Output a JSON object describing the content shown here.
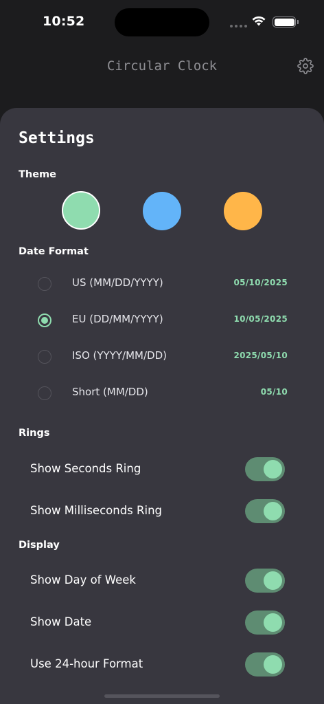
{
  "status": {
    "time": "10:52"
  },
  "header": {
    "title": "Circular Clock"
  },
  "settings": {
    "title": "Settings",
    "theme": {
      "label": "Theme",
      "swatches": [
        {
          "color": "#8fdcaf",
          "selected": true
        },
        {
          "color": "#63b4f9",
          "selected": false
        },
        {
          "color": "#ffb649",
          "selected": false
        }
      ]
    },
    "date_format": {
      "label": "Date Format",
      "options": [
        {
          "label": "US (MM/DD/YYYY)",
          "preview": "05/10/2025",
          "selected": false
        },
        {
          "label": "EU (DD/MM/YYYY)",
          "preview": "10/05/2025",
          "selected": true
        },
        {
          "label": "ISO (YYYY/MM/DD)",
          "preview": "2025/05/10",
          "selected": false
        },
        {
          "label": "Short (MM/DD)",
          "preview": "05/10",
          "selected": false
        }
      ]
    },
    "rings": {
      "label": "Rings",
      "toggles": [
        {
          "label": "Show Seconds Ring",
          "on": true
        },
        {
          "label": "Show Milliseconds Ring",
          "on": true
        }
      ]
    },
    "display": {
      "label": "Display",
      "toggles": [
        {
          "label": "Show Day of Week",
          "on": true
        },
        {
          "label": "Show Date",
          "on": true
        },
        {
          "label": "Use 24-hour Format",
          "on": true
        }
      ]
    }
  },
  "colors": {
    "accent": "#8fdcaf",
    "sheet": "#38373f",
    "background": "#1c1c1e"
  }
}
